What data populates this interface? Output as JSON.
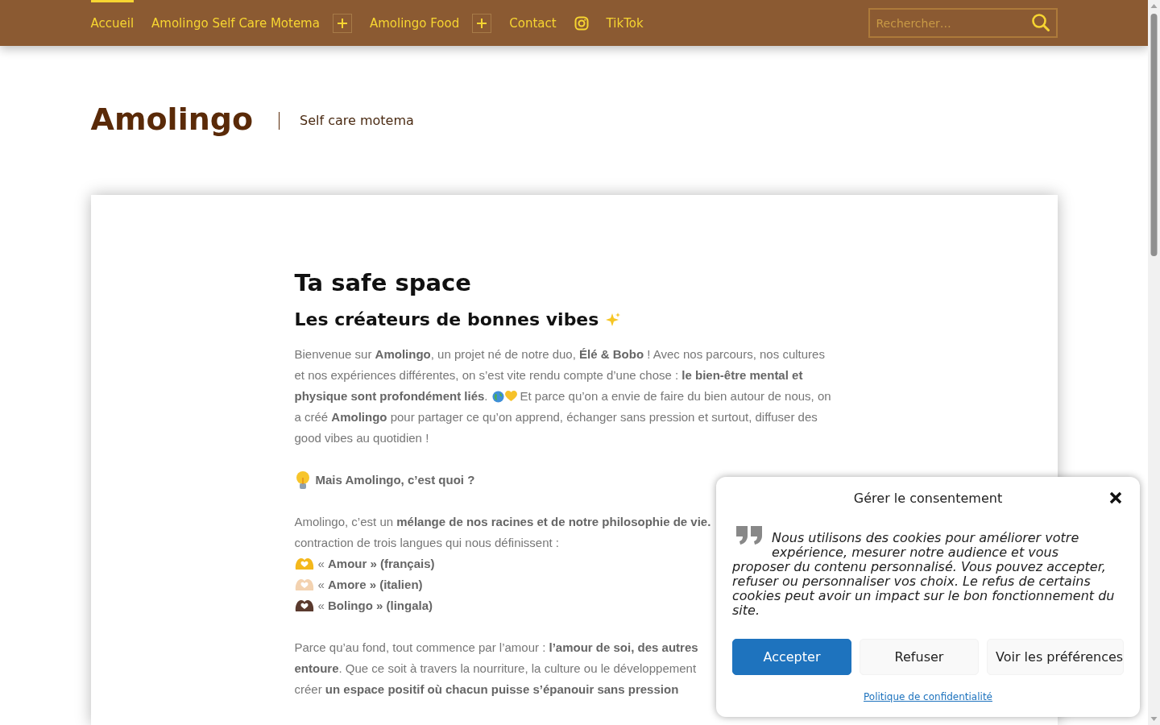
{
  "header": {
    "nav": [
      {
        "kind": "link",
        "label": "Accueil",
        "selected": true,
        "submenu": false
      },
      {
        "kind": "link",
        "label": "Amolingo Self Care Motema",
        "selected": false,
        "submenu": true
      },
      {
        "kind": "link",
        "label": "Amolingo Food",
        "selected": false,
        "submenu": true
      },
      {
        "kind": "link",
        "label": "Contact",
        "selected": false,
        "submenu": false
      },
      {
        "kind": "instagram",
        "selected": false,
        "submenu": false
      },
      {
        "kind": "link",
        "label": "TikTok",
        "selected": false,
        "submenu": false
      }
    ],
    "search": {
      "placeholder": "Rechercher…"
    }
  },
  "branding": {
    "title": "Amolingo",
    "tagline": "Self care motema"
  },
  "article": {
    "title": "Ta safe space",
    "subtitle": "Les créateurs de bonnes vibes",
    "intro_lines": [
      {
        "text": "Bienvenue sur **Amolingo**, un projet né de notre duo, **Élé & Bobo** ! Avec nos parcours, nos cultures"
      },
      {
        "text": "et nos expériences différentes, on s’est vite rendu compte d’une chose : **le bien-être mental et**"
      },
      {
        "text": "**physique sont profondément liés**.",
        "after_icons": "Et parce qu’on a envie de faire du bien autour de nous, on"
      },
      {
        "text": "a créé **Amolingo** pour partager ce qu’on apprend, échanger sans pression et surtout, diffuser des"
      },
      {
        "text": "good vibes au quotidien !"
      }
    ],
    "section_heading": "Mais Amolingo, c’est quoi ?",
    "paragraph_2_lines": [
      "Amolingo, c’est un **mélange de nos racines et de notre philosophie de vie.**",
      "contraction de trois langues qui nous définissent :"
    ],
    "languages": [
      {
        "text": "« **Amour » (français)**",
        "color": "#f4b81c"
      },
      {
        "text": "« **Amore » (italien)**",
        "color": "#f3d2b0"
      },
      {
        "text": "« **Bolingo » (lingala)**",
        "color": "#5a3a2e"
      }
    ],
    "paragraph_3_lines": [
      "Parce qu’au fond, tout commence par l’amour : **l’amour de soi, des autres**",
      "**entoure**. Que ce soit à travers la nourriture, la culture ou le développement",
      "créer **un espace positif où chacun puisse s’épanouir sans pression**"
    ]
  },
  "consent": {
    "title": "Gérer le consentement",
    "message_beside_quote": "Nous utilisons des cookies pour améliorer votre expérience, mesurer notre audience et vous",
    "message_rest": "proposer du contenu personnalisé. Vous pouvez accepter, refuser ou personnaliser vos choix. Le refus de certains cookies peut avoir un impact sur le bon fonctionnement du site.",
    "buttons": [
      {
        "label": "Accepter",
        "kind": "primary"
      },
      {
        "label": "Refuser",
        "kind": "secondary"
      },
      {
        "label": "Voir les préférences",
        "kind": "secondary"
      }
    ],
    "link": "Politique de confidentialité"
  }
}
